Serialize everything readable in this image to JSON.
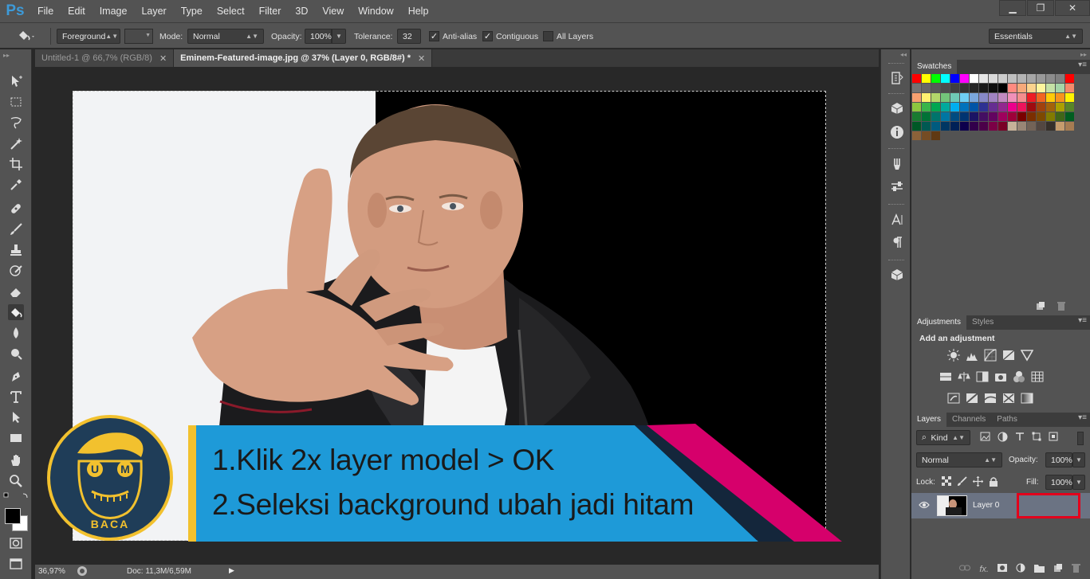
{
  "app": {
    "logo": "Ps",
    "menu": [
      "File",
      "Edit",
      "Image",
      "Layer",
      "Type",
      "Select",
      "Filter",
      "3D",
      "View",
      "Window",
      "Help"
    ]
  },
  "window_controls": {
    "minimize": "▁",
    "restore": "❐",
    "close": "✕"
  },
  "options": {
    "fill_source": "Foreground",
    "mode_label": "Mode:",
    "mode_value": "Normal",
    "opacity_label": "Opacity:",
    "opacity_value": "100%",
    "tolerance_label": "Tolerance:",
    "tolerance_value": "32",
    "antialias_label": "Anti-alias",
    "antialias_checked": true,
    "contiguous_label": "Contiguous",
    "contiguous_checked": true,
    "all_layers_label": "All Layers",
    "all_layers_checked": false,
    "workspace": "Essentials"
  },
  "tabs": [
    {
      "label": "Untitled-1 @ 66,7% (RGB/8)",
      "active": false
    },
    {
      "label": "Eminem-Featured-image.jpg @ 37% (Layer 0, RGB/8#) *",
      "active": true
    }
  ],
  "banner": {
    "line1": "1.Klik 2x layer model > OK",
    "line2": "2.Seleksi background ubah jadi hitam",
    "logo_text": "BACA",
    "logo_letters": [
      "U",
      "M"
    ],
    "colors": {
      "blue": "#1e9ad8",
      "navy": "#14263b",
      "magenta": "#d6006b",
      "yellow": "#f2c12e"
    }
  },
  "status": {
    "zoom": "36,97%",
    "doc": "Doc: 11,3M/6,59M"
  },
  "panels": {
    "swatches_tab": "Swatches",
    "adjustments_tab": "Adjustments",
    "styles_tab": "Styles",
    "add_adjustment": "Add an adjustment",
    "layers_tab": "Layers",
    "channels_tab": "Channels",
    "paths_tab": "Paths",
    "kind_label": "Kind",
    "blend_mode": "Normal",
    "opacity_label": "Opacity:",
    "opacity_value": "100%",
    "lock_label": "Lock:",
    "fill_label": "Fill:",
    "fill_value": "100%",
    "layer_name": "Layer 0"
  },
  "swatch_colors": [
    [
      "#ff0000",
      "#ffff00",
      "#00ff00",
      "#00ffff",
      "#0000ff",
      "#ff00ff",
      "#ffffff",
      "#e6e6e6",
      "#d9d9d9",
      "#cccccc",
      "#bfbfbf",
      "#b3b3b3",
      "#a6a6a6",
      "#999999",
      "#8c8c8c",
      "#808080",
      "#ff0000"
    ],
    [
      "#737373",
      "#666666",
      "#595959",
      "#4d4d4d",
      "#404040",
      "#333333",
      "#262626",
      "#1a1a1a",
      "#0d0d0d",
      "#000000",
      "#ff8a80",
      "#f6a97a",
      "#fbd38d",
      "#fff59d",
      "#c5e1a5",
      "#a5d6a7",
      "#f48a6b"
    ],
    [
      "#f7a070",
      "#fff170",
      "#b4d66a",
      "#73c57a",
      "#6fcab6",
      "#6ecff4",
      "#7aa7dc",
      "#8789c8",
      "#a083c2",
      "#c28ac0",
      "#f090b9",
      "#f48e8e",
      "#ed1c24",
      "#f26522",
      "#ffca08",
      "#f7941d",
      "#fff200"
    ],
    [
      "#8dc63f",
      "#39b54a",
      "#00a651",
      "#00a99d",
      "#00aeef",
      "#0072bc",
      "#0054a6",
      "#2e3192",
      "#662d91",
      "#92278f",
      "#ec008c",
      "#ed145b",
      "#9e0b0f",
      "#a0410d",
      "#a3620a",
      "#aba000",
      "#598527"
    ],
    [
      "#197b30",
      "#007236",
      "#00746b",
      "#0076a3",
      "#004b80",
      "#003471",
      "#1b1464",
      "#440e62",
      "#630460",
      "#9e005d",
      "#9e0039",
      "#790000",
      "#7b2e00",
      "#7d4900",
      "#827b00",
      "#406618",
      "#005e20"
    ],
    [
      "#005826",
      "#005952",
      "#005b7f",
      "#003663",
      "#002157",
      "#0d004c",
      "#32004b",
      "#4b0049",
      "#7b0046",
      "#7a0026",
      "#c7b299",
      "#998675",
      "#736357",
      "#534741",
      "#37302a",
      "#c69c6d",
      "#a67c52"
    ],
    [
      "#8c6239",
      "#754c24",
      "#603913"
    ]
  ]
}
